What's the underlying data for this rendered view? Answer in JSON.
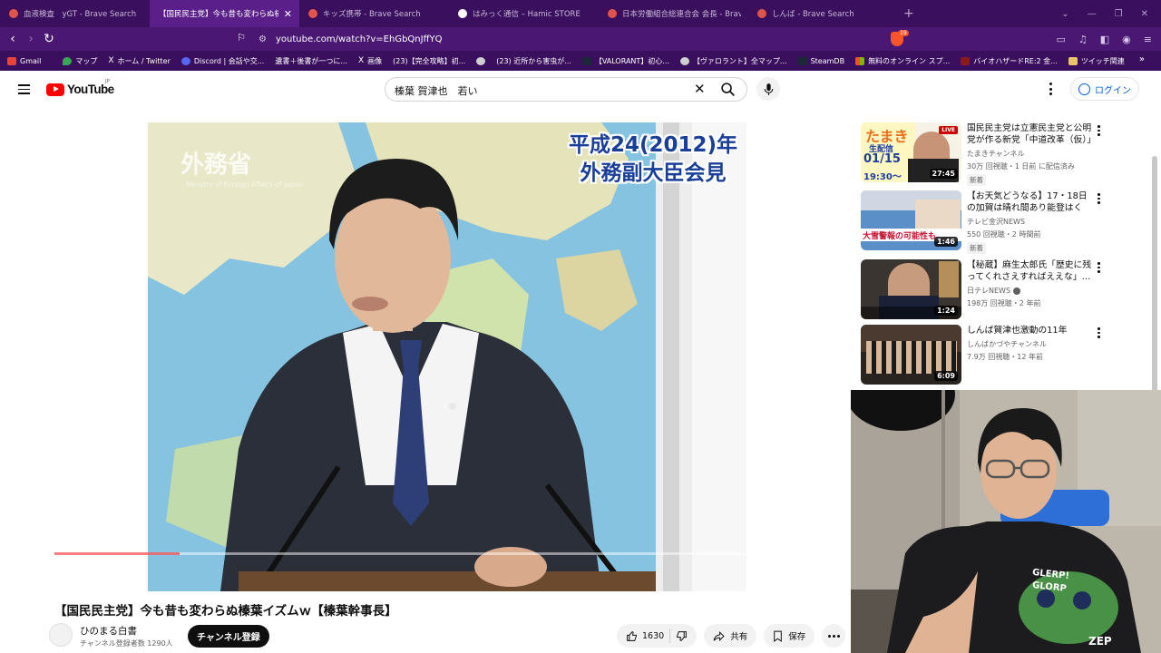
{
  "browser": {
    "tabs": [
      {
        "title": "血液検査　yGT - Brave Search",
        "icon": "brave-search-icon",
        "active": false
      },
      {
        "title": "【国民民主党】今も昔も変わらぬ榛葉",
        "icon": "youtube-icon",
        "active": true
      },
      {
        "title": "キッズ携帯 - Brave Search",
        "icon": "brave-search-icon",
        "active": false
      },
      {
        "title": "はみっく通信 – Hamic STORE",
        "icon": "hamic-icon",
        "active": false
      },
      {
        "title": "日本労働組合総連合会 会長 - Brave",
        "icon": "brave-search-icon",
        "active": false
      },
      {
        "title": "しんば - Brave Search",
        "icon": "brave-search-icon",
        "active": false
      }
    ],
    "new_tab": "+",
    "url": "youtube.com/watch?v=EhGbQnJffYQ",
    "shields_count": "19",
    "bookmarks": [
      {
        "label": "Gmail",
        "icon": "gmail-icon"
      },
      {
        "label": "",
        "icon": "youtube-icon"
      },
      {
        "label": "マップ",
        "icon": "maps-icon"
      },
      {
        "label": "ホーム / Twitter",
        "icon": "x-icon"
      },
      {
        "label": "Discord | 会話や交...",
        "icon": "discord-icon"
      },
      {
        "label": "遺書＋後書が一つに...",
        "icon": "youtube-icon"
      },
      {
        "label": "画像",
        "icon": "x-icon"
      },
      {
        "label": "(23)【完全攻略】初...",
        "icon": "youtube-icon"
      },
      {
        "label": "",
        "icon": "globe-icon"
      },
      {
        "label": "(23) 近所から害虫が...",
        "icon": "youtube-icon"
      },
      {
        "label": "【VALORANT】初心...",
        "icon": "globe-icon"
      },
      {
        "label": "【ヴァロラント】全マップ...",
        "icon": "globe-icon"
      },
      {
        "label": "SteamDB",
        "icon": "steam-icon"
      },
      {
        "label": "無料のオンライン スプ...",
        "icon": "microsoft-icon"
      },
      {
        "label": "バイオハザードRE:2 金...",
        "icon": "biohazard-icon"
      },
      {
        "label": "ツイッチ関連",
        "icon": "folder-icon"
      }
    ]
  },
  "youtube": {
    "logo_text": "YouTube",
    "region": "JP",
    "search_query": "榛葉 賀津也　若い",
    "login_label": "ログイン",
    "video": {
      "overlay_line1": "平成24(2012)年",
      "overlay_line2": "外務副大臣会見",
      "mofa_logo": "外務省",
      "mofa_sub": "Ministry of Foreign Affairs of Japan",
      "progress": 0.16,
      "title": "【国民民主党】今も昔も変わらぬ榛葉イズムｗ【榛葉幹事長】"
    },
    "channel": {
      "name": "ひのまる白書",
      "subscribers": "チャンネル登録者数 1290人",
      "subscribe_label": "チャンネル登録"
    },
    "actions": {
      "like_count": "1630",
      "share_label": "共有",
      "save_label": "保存"
    },
    "recommendations": [
      {
        "title": "国民民主党は立憲民主党と公明党が作る新党「中道改革（仮）」",
        "channel": "たまきチャンネル",
        "meta": "30万 回視聴・1 日前 に配信済み",
        "badge": "新着",
        "duration": "27:45",
        "live": "LIVE",
        "thumb_text1": "たまき",
        "thumb_text2": "生配信",
        "thumb_text3": "01/15",
        "thumb_text4": "19:30～"
      },
      {
        "title": "【お天気どうなる】17・18日の加賀は晴れ間あり能登はくも…",
        "channel": "テレビ金沢NEWS",
        "meta": "550 回視聴・2 時間前",
        "badge": "新着",
        "duration": "1:46",
        "live": "",
        "thumb_text1": "大雪警報の可能性も",
        "thumb_text2": "",
        "thumb_text3": "",
        "thumb_text4": ""
      },
      {
        "title": "【秘蔵】麻生太郎氏「歴史に残ってくれさえすればええな」…",
        "channel": "日テレNEWS",
        "meta": "198万 回視聴・2 年前",
        "badge": "",
        "duration": "1:24",
        "live": "",
        "thumb_text1": "",
        "thumb_text2": "",
        "thumb_text3": "",
        "thumb_text4": ""
      },
      {
        "title": "しんば賀津也激動の11年",
        "channel": "しんばかづやチャンネル",
        "meta": "7.9万 回視聴・12 年前",
        "badge": "",
        "duration": "6:09",
        "live": "",
        "thumb_text1": "",
        "thumb_text2": "",
        "thumb_text3": "",
        "thumb_text4": ""
      }
    ]
  },
  "webcam": {
    "shirt_text1": "GLERP!",
    "shirt_text2": "GLORP",
    "shirt_text3": "ZEP"
  }
}
